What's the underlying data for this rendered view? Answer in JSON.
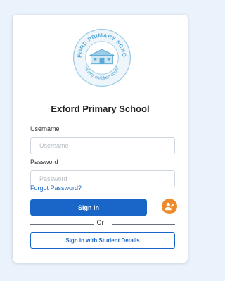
{
  "logo": {
    "top_text": "EXFORD PRIMARY SCHOOL",
    "bottom_text": "where children count"
  },
  "school_name": "Exford Primary School",
  "form": {
    "username_label": "Username",
    "username_placeholder": "Username",
    "username_value": "",
    "password_label": "Password",
    "password_placeholder": "Password",
    "password_value": "",
    "forgot_link": "Forgot Password?",
    "sign_in_label": "Sign in",
    "or_label": "Or",
    "student_sign_in_label": "Sign in with Student Details",
    "alt_sign_in_icon": "person-icon"
  },
  "colors": {
    "accent": "#1a66c8",
    "orange": "#ee8a2a",
    "background": "#eaf2fb"
  }
}
